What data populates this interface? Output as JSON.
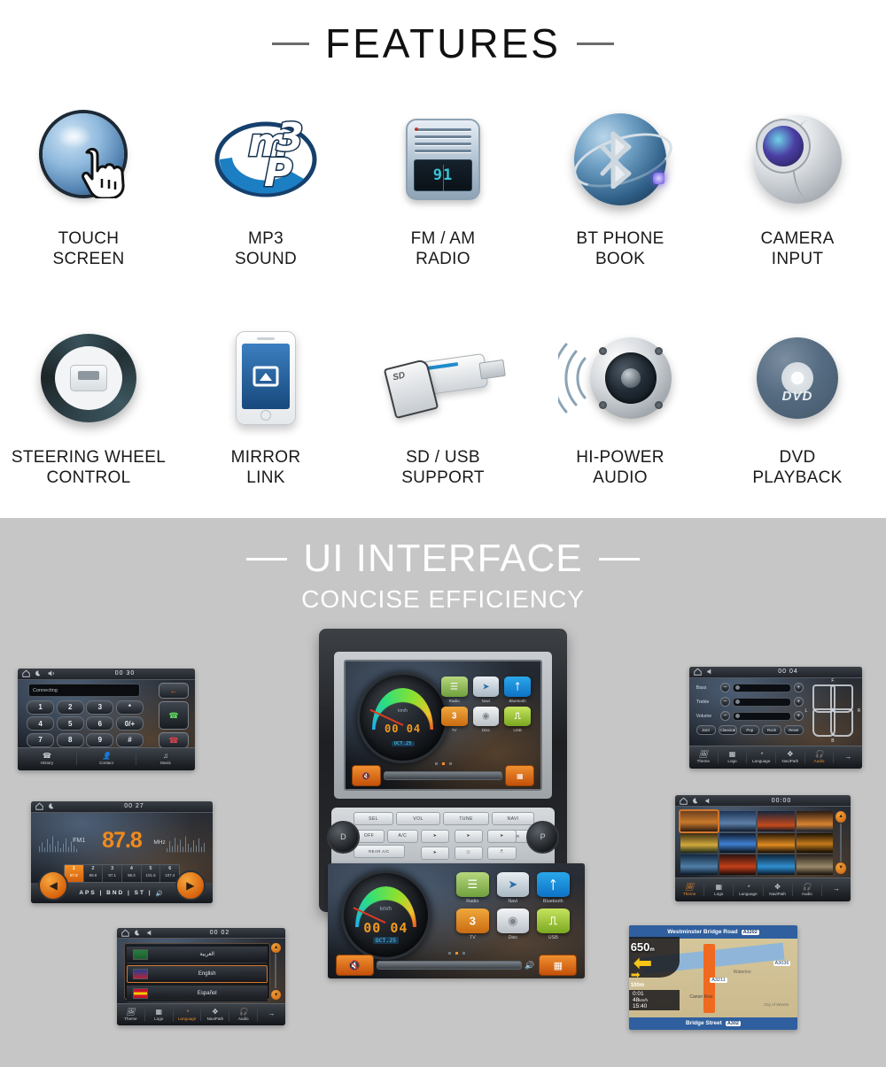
{
  "features": {
    "title": "FEATURES",
    "items": [
      {
        "icon": "touch-screen-icon",
        "label": "TOUCH\nSCREEN"
      },
      {
        "icon": "mp3-icon",
        "label": "MP3\nSOUND"
      },
      {
        "icon": "radio-icon",
        "label": "FM / AM\nRADIO"
      },
      {
        "icon": "bluetooth-icon",
        "label": "BT PHONE\nBOOK"
      },
      {
        "icon": "camera-icon",
        "label": "CAMERA\nINPUT"
      },
      {
        "icon": "steering-wheel-icon",
        "label": "STEERING WHEEL\nCONTROL"
      },
      {
        "icon": "phone-mirror-icon",
        "label": "MIRROR\nLINK"
      },
      {
        "icon": "sd-usb-icon",
        "label": "SD / USB\nSUPPORT"
      },
      {
        "icon": "speaker-icon",
        "label": "HI-POWER\nAUDIO"
      },
      {
        "icon": "dvd-disc-icon",
        "label": "DVD\nPLAYBACK"
      }
    ],
    "mp3_logo_text": "MP3",
    "radio_display": "91",
    "dvd_label": "DVD"
  },
  "ui_interface": {
    "title": "UI INTERFACE",
    "subtitle": "CONCISE  EFFICIENCY"
  },
  "screens": {
    "dialer": {
      "clock": "00 30",
      "field_value": "Connecting",
      "keys": [
        "1",
        "2",
        "3",
        "*",
        "4",
        "5",
        "6",
        "0/+",
        "7",
        "8",
        "9",
        "#"
      ],
      "back_icon": "back-arrow-icon",
      "dial_icon": "call-icon",
      "hangup_icon": "hangup-icon",
      "tabs": [
        {
          "label": "History",
          "icon": "history-icon"
        },
        {
          "label": "Contact",
          "icon": "contact-icon"
        },
        {
          "label": "Music",
          "icon": "music-icon"
        }
      ]
    },
    "radio": {
      "clock": "00 27",
      "band": "FM1",
      "frequency": "87.8",
      "unit": "MHz",
      "presets": [
        {
          "num": "1",
          "freq": "87.8",
          "selected": true
        },
        {
          "num": "2",
          "freq": "89.9",
          "selected": false
        },
        {
          "num": "3",
          "freq": "97.1",
          "selected": false
        },
        {
          "num": "4",
          "freq": "98.3",
          "selected": false
        },
        {
          "num": "5",
          "freq": "101.5",
          "selected": false
        },
        {
          "num": "6",
          "freq": "107.4",
          "selected": false
        }
      ],
      "controls": "APS | BND | ST |",
      "prev_icon": "prev-arrow-icon",
      "next_icon": "next-arrow-icon",
      "volume_icon": "volume-icon"
    },
    "language": {
      "clock": "00 02",
      "options": [
        {
          "name": "العربية",
          "selected": false
        },
        {
          "name": "English",
          "selected": true
        },
        {
          "name": "Español",
          "selected": false
        }
      ],
      "tabs": [
        {
          "label": "Theme",
          "icon": "theme-icon",
          "selected": false
        },
        {
          "label": "Logo",
          "icon": "logo-icon",
          "selected": false
        },
        {
          "label": "Language",
          "icon": "language-icon",
          "selected": true
        },
        {
          "label": "NaviPath",
          "icon": "navipath-icon",
          "selected": false
        },
        {
          "label": "Audio",
          "icon": "audio-icon",
          "selected": false
        }
      ],
      "next_icon": "next-arrow-icon"
    },
    "audio": {
      "clock": "00 04",
      "sliders": [
        {
          "label": "Bass"
        },
        {
          "label": "Treble"
        },
        {
          "label": "Volume"
        }
      ],
      "presets": [
        "Jazz",
        "Classical",
        "Pop",
        "Rock",
        "Reset"
      ],
      "balance_labels": {
        "front": "F",
        "rear": "B",
        "left": "L",
        "right": "R"
      },
      "tabs": [
        {
          "label": "Theme",
          "icon": "theme-icon",
          "selected": false
        },
        {
          "label": "Logo",
          "icon": "logo-icon",
          "selected": false
        },
        {
          "label": "Language",
          "icon": "language-icon",
          "selected": false
        },
        {
          "label": "NaviPath",
          "icon": "navipath-icon",
          "selected": false
        },
        {
          "label": "Audio",
          "icon": "audio-icon",
          "selected": true
        }
      ],
      "next_icon": "next-arrow-icon"
    },
    "theme": {
      "clock": "00:00",
      "tabs": [
        {
          "label": "Theme",
          "icon": "theme-icon",
          "selected": true
        },
        {
          "label": "Logo",
          "icon": "logo-icon",
          "selected": false
        },
        {
          "label": "Language",
          "icon": "language-icon",
          "selected": false
        },
        {
          "label": "NaviPath",
          "icon": "navipath-icon",
          "selected": false
        },
        {
          "label": "Audio",
          "icon": "audio-icon",
          "selected": false
        }
      ],
      "next_icon": "next-arrow-icon"
    },
    "navigation": {
      "distance": "650",
      "distance_unit": "m",
      "next_distance": "100m",
      "eta": "0:01",
      "speed": "48",
      "speed_unit": "km/h",
      "time": "15:40",
      "top_road": "Westminster Bridge Road",
      "top_road_tag": "A3202",
      "bottom_road": "Bridge Street",
      "bottom_road_tag": "A302",
      "map_labels": [
        "A3211",
        "A3036",
        "Canon Row",
        "City of Westm",
        "Waterloo"
      ],
      "turn_icon": "turn-left-icon",
      "next_turn_icon": "turn-right-icon"
    },
    "home": {
      "clock": "00 04",
      "speed_unit": "km/h",
      "date": "OCT.25",
      "apps": [
        {
          "label": "Radio",
          "icon": "radio-app-icon"
        },
        {
          "label": "Navi",
          "icon": "navi-app-icon"
        },
        {
          "label": "Bluetooth",
          "icon": "bluetooth-app-icon"
        },
        {
          "label": "TV",
          "icon": "tv-app-icon"
        },
        {
          "label": "Disc",
          "icon": "disc-app-icon"
        },
        {
          "label": "USB",
          "icon": "usb-app-icon"
        }
      ],
      "mute_icon": "mute-icon",
      "menu_icon": "menu-grid-icon",
      "volume_icon": "volume-icon"
    },
    "head_unit_buttons": {
      "row_top": [
        "SEL",
        "VOL",
        "TUNE",
        "NAVI"
      ],
      "vol_minus": "−",
      "vol_plus": "+",
      "row_climate": [
        "OFF",
        "A/C",
        "REAR A/C",
        "REAR"
      ],
      "left_knob": "D",
      "right_knob": "P"
    }
  }
}
